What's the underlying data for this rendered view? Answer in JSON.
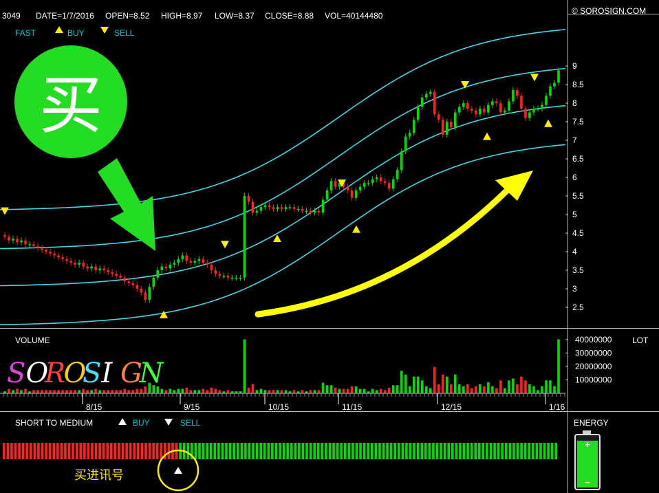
{
  "header": {
    "code": "3049",
    "date": "DATE=1/7/2016",
    "open": "OPEN=8.52",
    "high": "HIGH=8.97",
    "low": "LOW=8.37",
    "close": "CLOSE=8.88",
    "vol": "VOL=40144480",
    "copyright": "© SOROSIGN.COM"
  },
  "legend": {
    "fast": "FAST",
    "buy": "BUY",
    "sell": "SELL"
  },
  "callout": {
    "buy_char": "买",
    "signal_caption": "买进讯号"
  },
  "volume_panel": {
    "title": "VOLUME",
    "unit": "LOT",
    "brand": "SOROSIGN",
    "brand_colors": [
      "#e040e0",
      "#ffffff",
      "#ff4040",
      "#ffd000",
      "#40e0ff",
      "#ffffff",
      "#ff8040",
      "#40ff40"
    ]
  },
  "indicator_panel": {
    "title": "SHORT TO MEDIUM",
    "buy": "BUY",
    "sell": "SELL",
    "red_bars": 46,
    "green_bars": 99,
    "energy_title": "ENERGY",
    "energy_level": 0.92
  },
  "colors": {
    "up": "#00e000",
    "down": "#ff2020",
    "band": "#40d8e8",
    "signal": "#ffee00",
    "annotation_green": "#22dd22",
    "arrow_yellow": "#ffff00"
  },
  "chart_data": [
    {
      "type": "candlestick",
      "title": "3049",
      "x_ticks": [
        "8/15",
        "9/15",
        "10/15",
        "11/15",
        "12/15",
        "1/16"
      ],
      "y_ticks": [
        2.5,
        3,
        3.5,
        4,
        4.5,
        5,
        5.5,
        6,
        6.5,
        7,
        7.5,
        8,
        8.5,
        9
      ],
      "ylim": [
        2.1,
        9.3
      ],
      "close": [
        4.4,
        4.3,
        4.35,
        4.25,
        4.3,
        4.2,
        4.2,
        4.15,
        4.1,
        4.05,
        4.0,
        3.95,
        3.9,
        3.85,
        3.8,
        3.75,
        3.7,
        3.65,
        3.7,
        3.6,
        3.55,
        3.6,
        3.5,
        3.55,
        3.5,
        3.45,
        3.4,
        3.35,
        3.3,
        3.2,
        3.15,
        3.1,
        3.0,
        2.9,
        2.7,
        3.05,
        3.3,
        3.5,
        3.6,
        3.55,
        3.65,
        3.7,
        3.8,
        3.9,
        3.75,
        3.7,
        3.75,
        3.8,
        3.7,
        3.65,
        3.5,
        3.4,
        3.35,
        3.35,
        3.3,
        3.3,
        3.3,
        3.3,
        5.5,
        5.35,
        5.05,
        5.1,
        5.2,
        5.25,
        5.2,
        5.15,
        5.2,
        5.15,
        5.2,
        5.2,
        5.15,
        5.15,
        5.1,
        5.1,
        5.05,
        5.1,
        5.05,
        5.4,
        5.65,
        5.9,
        5.75,
        5.85,
        5.75,
        5.65,
        5.45,
        5.65,
        5.75,
        5.85,
        5.85,
        5.95,
        6.0,
        5.9,
        5.85,
        5.7,
        5.95,
        6.2,
        6.7,
        7.1,
        7.2,
        7.55,
        7.9,
        8.15,
        8.25,
        8.3,
        7.7,
        7.55,
        7.15,
        7.5,
        7.35,
        7.75,
        7.9,
        8.0,
        7.85,
        7.8,
        7.7,
        7.85,
        7.75,
        7.95,
        8.05,
        8.0,
        7.75,
        7.8,
        8.05,
        8.35,
        8.2,
        7.85,
        7.6,
        7.75,
        7.85,
        7.85,
        7.95,
        8.2,
        8.45,
        8.55,
        8.88
      ],
      "volume_peaks": [
        {
          "x_tick": "12/15",
          "note": "spikes"
        },
        {
          "x_tick": "1/16",
          "value": 40144480
        }
      ],
      "volume_ticks": [
        10000000,
        20000000,
        30000000,
        40000000
      ],
      "volume_ylim": [
        0,
        42000000
      ],
      "buy_signals": [
        {
          "at": "8/15",
          "price": 2.3
        },
        {
          "at": "10/15",
          "price": 4.35
        },
        {
          "at": "11/15",
          "price": 4.6
        },
        {
          "at": "12/15",
          "price": 7.1
        },
        {
          "at": "1/16",
          "price": 7.45
        }
      ],
      "sell_signals": [
        {
          "at": "8/15",
          "price": 5.1
        },
        {
          "at": "9/15",
          "price": 4.2
        },
        {
          "at": "11/15",
          "price": 5.85
        },
        {
          "at": "12/15",
          "price": 8.5
        },
        {
          "at": "1/16",
          "price": 8.7
        }
      ],
      "legend": [
        "FAST",
        "BUY",
        "SELL"
      ],
      "grid": false
    }
  ]
}
